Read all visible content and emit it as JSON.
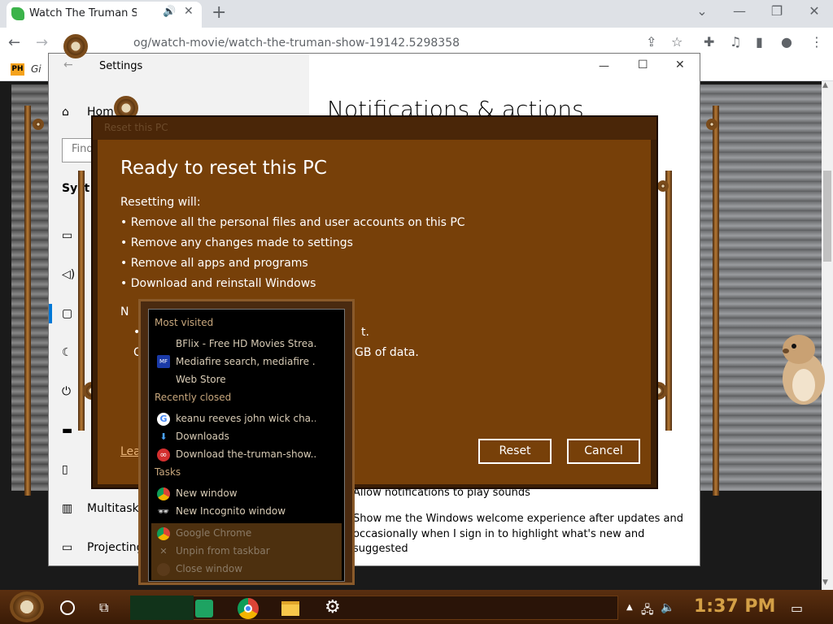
{
  "browser": {
    "tab_title": "Watch The Truman Show",
    "tab_audio_icon": "speaker-icon",
    "tab_close": "✕",
    "new_tab": "+",
    "url": "og/watch-movie/watch-the-truman-show-19142.5298358",
    "bookmark_label": "Gi",
    "bookmark_icon_text": "PH",
    "window_controls": [
      "⌄",
      "—",
      "❐",
      "✕"
    ]
  },
  "settings": {
    "title": "Settings",
    "heading": "Notifications & actions",
    "find_placeholder": "Find",
    "sidebar": {
      "home": "Hom",
      "system": "Syst",
      "multitasking": "Multitaskin",
      "projecting": "Projecting"
    },
    "notif_lines": [
      "Allow notifications to play sounds",
      "Show me the Windows welcome experience after updates and",
      "occasionally when I sign in to highlight what's new and",
      "suggested"
    ],
    "window_controls": [
      "—",
      "☐",
      "✕"
    ]
  },
  "reset_dialog": {
    "titlebar": "Reset this PC",
    "title": "Ready to reset this PC",
    "intro": "Resetting will:",
    "bullets": [
      "Remove all the personal files and user accounts on this PC",
      "Remove any changes made to settings",
      "Remove all apps and programs",
      "Download and reinstall Windows"
    ],
    "partial_heading": "N",
    "partial_line1_end": "t.",
    "partial_line2_start": "C",
    "partial_line2_end": "GB of data.",
    "learn_more": "Lea",
    "reset_button": "Reset",
    "cancel_button": "Cancel"
  },
  "jumplist": {
    "most_visited_header": "Most visited",
    "most_visited": [
      "BFlix - Free HD Movies Strea...",
      "Mediafire search, mediafire ...",
      "Web Store"
    ],
    "recently_closed_header": "Recently closed",
    "recently_closed": [
      "keanu reeves john wick cha...",
      "Downloads",
      "Download the-truman-show...."
    ],
    "tasks_header": "Tasks",
    "tasks": [
      "New window",
      "New Incognito window"
    ],
    "footer": [
      "Google Chrome",
      "Unpin from taskbar",
      "Close window"
    ]
  },
  "taskbar": {
    "clock": "1:37 PM",
    "apps": [
      "sheets-app",
      "chrome-app",
      "file-explorer-app",
      "settings-app"
    ]
  },
  "colors": {
    "dialog_bg": "#774009",
    "clock": "#d4a046",
    "jumplist_bg": "#000000"
  }
}
